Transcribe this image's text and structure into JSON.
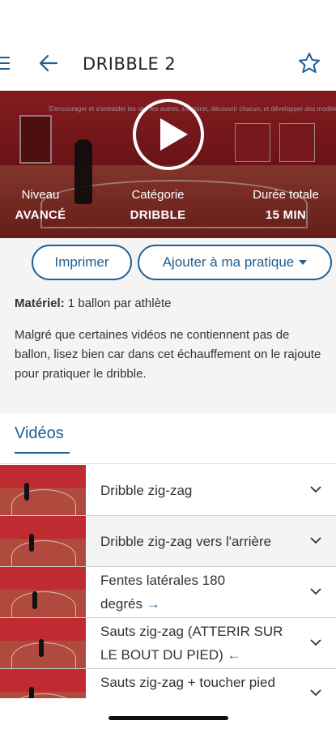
{
  "header": {
    "title": "DRIBBLE 2",
    "menu_icon": "menu-icon",
    "back_icon": "back-arrow-icon",
    "favorite_icon": "star-icon"
  },
  "hero": {
    "wall_text": "S'encourager et s'entraider les uns les autres, s'inspirer, découvrir chacun, et développer des modèles de réussite dyna...",
    "play_icon": "play-icon",
    "stats": [
      {
        "label": "Niveau",
        "value": "AVANCÉ"
      },
      {
        "label": "Catégorie",
        "value": "DRIBBLE"
      },
      {
        "label": "Durée totale",
        "value": "15 MIN"
      }
    ]
  },
  "actions": {
    "print_label": "Imprimer",
    "add_label": "Ajouter à ma pratique"
  },
  "details": {
    "material_label": "Matériel:",
    "material_value": " 1 ballon par athlète",
    "description": "Malgré que certaines vidéos ne contiennent pas de ballon, lisez bien car dans cet échauffement on le rajoute pour pratiquer le dribble."
  },
  "videos": {
    "section_title": "Vidéos",
    "items": [
      {
        "label": "Dribble zig-zag"
      },
      {
        "label": "Dribble zig-zag vers l'arrière"
      },
      {
        "label": "Fentes latérales 180 degrés",
        "line1": "Fentes latérales 180",
        "line2": "degrés",
        "arrow": "→"
      },
      {
        "label": "Sauts zig-zag (ATTERIR SUR LE BOUT DU PIED)",
        "line1": "Sauts zig-zag (ATTERIR SUR",
        "line2": "LE BOUT DU PIED)",
        "arrow": "←"
      },
      {
        "label": "Sauts zig-zag + toucher pied"
      }
    ]
  },
  "colors": {
    "accent": "#1f5f93",
    "hero_red": "#b8262c",
    "panel_gray": "#f4f4f4"
  }
}
